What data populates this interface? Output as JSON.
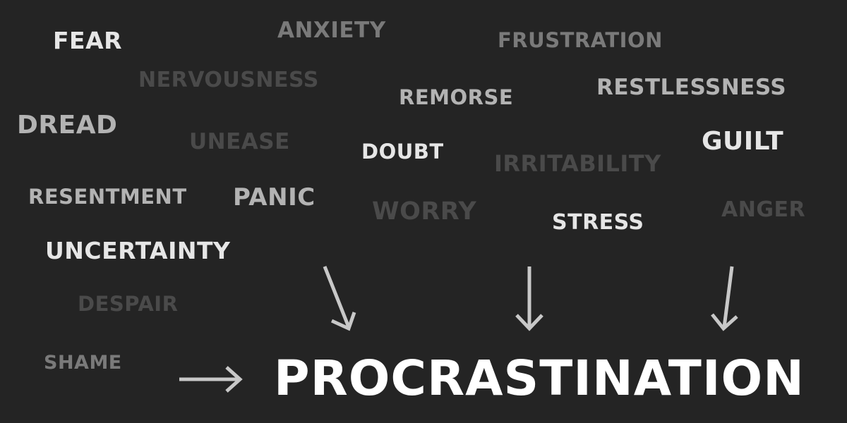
{
  "colors": {
    "background": "#242424",
    "white": "#ffffff",
    "light": "#e6e6e6",
    "mid": "#b3b3b3",
    "dim": "#7a7a7a",
    "faint": "#4a4a4a",
    "arrow": "#c8c8c8"
  },
  "words": {
    "fear": "FEAR",
    "anxiety": "ANXIETY",
    "frustration": "FRUSTRATION",
    "nervousness": "NERVOUSNESS",
    "remorse": "REMORSE",
    "restlessness": "RESTLESSNESS",
    "dread": "DREAD",
    "unease": "UNEASE",
    "doubt": "DOUBT",
    "irritability": "IRRITABILITY",
    "guilt": "GUILT",
    "resentment": "RESENTMENT",
    "panic": "PANIC",
    "worry": "WORRY",
    "stress": "STRESS",
    "anger": "ANGER",
    "uncertainty": "UNCERTAINTY",
    "despair": "DESPAIR",
    "shame": "SHAME"
  },
  "main_word": "PROCRASTINATION"
}
